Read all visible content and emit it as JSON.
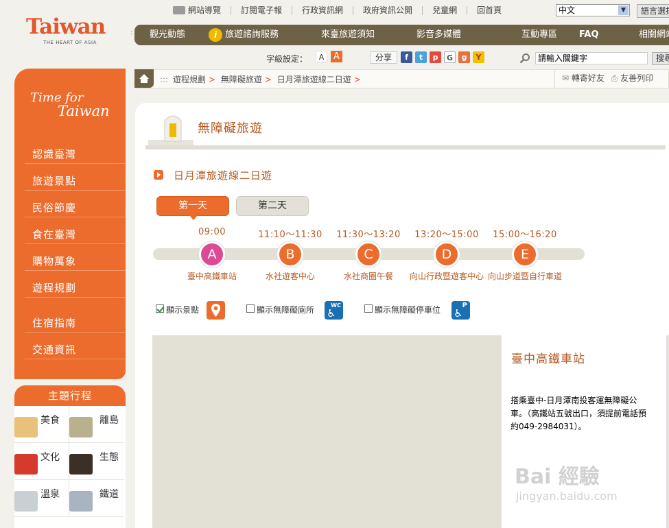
{
  "top_links": [
    "網站導覽",
    "訂閱電子報",
    "行政資訊網",
    "政府資訊公開",
    "兒童網",
    "回首頁"
  ],
  "language": {
    "selected": "中文",
    "button": "語言選擇"
  },
  "logo": {
    "word": "Taiwan",
    "tagline": "THE HEART OF ASIA"
  },
  "main_nav": [
    "觀光動態",
    "旅遊諮詢服務",
    "來臺旅遊須知",
    "影音多媒體",
    "互動專區",
    "FAQ",
    "相關網站"
  ],
  "toolbar": {
    "font_setting": "字級設定：",
    "font_small": "A",
    "font_large": "A",
    "share": "分享",
    "social": [
      "f",
      "t",
      "p",
      "G",
      "g",
      "Y"
    ],
    "search_placeholder": "請輸入關鍵字",
    "search_button": "搜尋"
  },
  "breadcrumb": {
    "dots": ":::",
    "items": [
      "遊程規劃",
      "無障礙旅遊",
      "日月潭旅遊線二日遊"
    ],
    "forward": "轉寄好友",
    "print": "友善列印"
  },
  "sidebar": {
    "brand_line1": "Time for",
    "brand_line2": "Taiwan",
    "items": [
      "認識臺灣",
      "旅遊景點",
      "民俗節慶",
      "食在臺灣",
      "購物萬象",
      "遊程規劃",
      "住宿指南",
      "交通資訊"
    ],
    "theme_title": "主題行程",
    "themes": [
      "美食",
      "離島",
      "文化",
      "生態",
      "溫泉",
      "鐵道"
    ]
  },
  "content": {
    "heading": "無障礙旅遊",
    "subtitle": "日月潭旅遊線二日遊",
    "tabs": [
      "第一天",
      "第二天"
    ],
    "stops": [
      {
        "letter": "A",
        "time": "09:00",
        "name": "臺中高鐵車站",
        "color": "#dc4a93"
      },
      {
        "letter": "B",
        "time": "11:10～11:30",
        "name": "水社遊客中心",
        "color": "#ec6c2d"
      },
      {
        "letter": "C",
        "time": "11:30～13:20",
        "name": "水社商圈午餐",
        "color": "#ec6c2d"
      },
      {
        "letter": "D",
        "time": "13:20～15:00",
        "name": "向山行政暨遊客中心",
        "color": "#ec6c2d"
      },
      {
        "letter": "E",
        "time": "15:00～16:20",
        "name": "向山步道暨自行車道",
        "color": "#ec6c2d"
      }
    ],
    "legend": [
      {
        "label": "顯示景點",
        "checked": true
      },
      {
        "label": "顯示無障礙廁所",
        "checked": false,
        "icon_text": "WC"
      },
      {
        "label": "顯示無障礙停車位",
        "checked": false,
        "icon_text": "P"
      }
    ],
    "map_panel": {
      "title": "臺中高鐵車站",
      "desc": "搭乘臺中-日月潭南投客運無障礙公車。（高鐵站五號出口，須提前電話預約049-2984031）。"
    }
  },
  "watermark": {
    "text": "Bai 經驗",
    "sub": "jingyan.baidu.com"
  }
}
